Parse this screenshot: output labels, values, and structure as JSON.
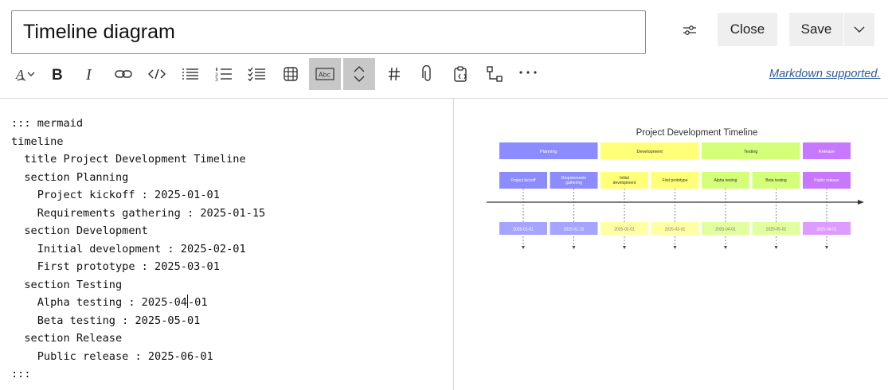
{
  "header": {
    "title_value": "Timeline diagram",
    "close_label": "Close",
    "save_label": "Save"
  },
  "toolbar": {
    "items": [
      "text-style-icon",
      "bold-icon",
      "italic-icon",
      "link-icon",
      "code-icon",
      "bulleted-list-icon",
      "numbered-list-icon",
      "checklist-icon",
      "table-icon",
      "text-box-icon",
      "collapse-icon",
      "heading-icon",
      "attachment-icon",
      "paste-code-icon",
      "diagram-icon",
      "more-icon"
    ],
    "markdown_link": "Markdown supported."
  },
  "editor": {
    "lines": [
      "::: mermaid",
      "timeline",
      "  title Project Development Timeline",
      "  section Planning",
      "    Project kickoff : 2025-01-01",
      "    Requirements gathering : 2025-01-15",
      "  section Development",
      "    Initial development : 2025-02-01",
      "    First prototype : 2025-03-01",
      "  section Testing",
      "    Alpha testing : 2025-04",
      "    Beta testing : 2025-05-01",
      "  section Release",
      "    Public release : 2025-06-01",
      ":::"
    ],
    "caret_line_tail": "-01"
  },
  "preview": {
    "title": "Project Development Timeline",
    "sections": [
      {
        "name": "Planning",
        "color": "#8c8cff",
        "text_color": "#ffffff",
        "date_color": "#a5a5ff",
        "tasks": [
          {
            "name": "Project kickoff",
            "date": "2025-01-01"
          },
          {
            "name": "Requirements gathering",
            "date": "2025-01-15"
          }
        ]
      },
      {
        "name": "Development",
        "color": "#ffff78",
        "text_color": "#333333",
        "date_color": "#ffffa6",
        "tasks": [
          {
            "name": "Initial development",
            "date": "2025-02-01"
          },
          {
            "name": "First prototype",
            "date": "2025-03-01"
          }
        ]
      },
      {
        "name": "Testing",
        "color": "#d4ff78",
        "text_color": "#333333",
        "date_color": "#e1ff9f",
        "tasks": [
          {
            "name": "Alpha testing",
            "date": "2025-04-01"
          },
          {
            "name": "Beta testing",
            "date": "2025-05-01"
          }
        ]
      },
      {
        "name": "Release",
        "color": "#c878ff",
        "text_color": "#ffffff",
        "date_color": "#dd9cff",
        "tasks": [
          {
            "name": "Public release",
            "date": "2025-06-01"
          }
        ]
      }
    ]
  }
}
